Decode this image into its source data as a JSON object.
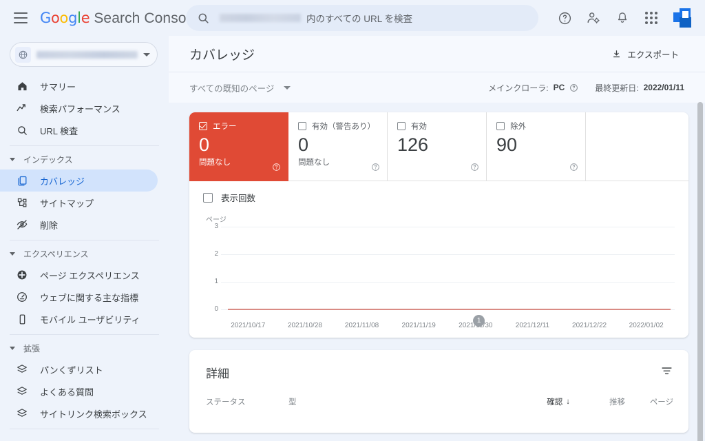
{
  "header": {
    "menu_icon": "hamburger-icon",
    "brand_google": [
      "G",
      "o",
      "o",
      "g",
      "l",
      "e"
    ],
    "brand_product": "Search Console",
    "search": {
      "icon": "search-icon",
      "placeholder_suffix": "内のすべての URL を検査",
      "value": ""
    },
    "icons": {
      "help": "help-icon",
      "account_settings": "account-settings-icon",
      "notifications": "bell-icon",
      "apps": "apps-grid-icon",
      "avatar": "avatar-logo"
    }
  },
  "sidebar": {
    "property_selector": {
      "icon": "globe-icon",
      "value": "",
      "chevron": "chevron-down-icon"
    },
    "items": [
      {
        "label": "サマリー",
        "icon": "home-icon",
        "active": false
      },
      {
        "label": "検索パフォーマンス",
        "icon": "trending-up-icon",
        "active": false
      },
      {
        "label": "URL 検査",
        "icon": "search-icon",
        "active": false
      }
    ],
    "groups": [
      {
        "label": "インデックス",
        "items": [
          {
            "label": "カバレッジ",
            "icon": "pages-copy-icon",
            "active": true
          },
          {
            "label": "サイトマップ",
            "icon": "sitemap-icon",
            "active": false
          },
          {
            "label": "削除",
            "icon": "eye-off-icon",
            "active": false
          }
        ]
      },
      {
        "label": "エクスペリエンス",
        "items": [
          {
            "label": "ページ エクスペリエンス",
            "icon": "page-experience-icon",
            "active": false
          },
          {
            "label": "ウェブに関する主な指標",
            "icon": "core-web-vitals-icon",
            "active": false
          },
          {
            "label": "モバイル ユーザビリティ",
            "icon": "mobile-icon",
            "active": false
          }
        ]
      },
      {
        "label": "拡張",
        "items": [
          {
            "label": "パンくずリスト",
            "icon": "layers-icon",
            "active": false
          },
          {
            "label": "よくある質問",
            "icon": "layers-icon",
            "active": false
          },
          {
            "label": "サイトリンク検索ボックス",
            "icon": "layers-icon",
            "active": false
          }
        ]
      }
    ]
  },
  "main": {
    "page_title": "カバレッジ",
    "export_label": "エクスポート",
    "export_icon": "download-icon",
    "filter_dropdown": "すべての既知のページ",
    "crawler_label": "メインクローラ:",
    "crawler_value": "PC",
    "crawler_help_icon": "help-circle-icon",
    "last_updated_label": "最終更新日:",
    "last_updated_value": "2022/01/11"
  },
  "cards": [
    {
      "label": "エラー",
      "value": "0",
      "sub": "問題なし",
      "selected": true,
      "style": "error"
    },
    {
      "label": "有効（警告あり）",
      "value": "0",
      "sub": "問題なし",
      "selected": false,
      "style": "warning"
    },
    {
      "label": "有効",
      "value": "126",
      "sub": "",
      "selected": false,
      "style": "valid"
    },
    {
      "label": "除外",
      "value": "90",
      "sub": "",
      "selected": false,
      "style": "excluded"
    }
  ],
  "chart_controls": {
    "impressions_label": "表示回数",
    "impressions_checked": false
  },
  "chart_data": {
    "type": "line",
    "title": "",
    "ylabel": "ページ",
    "xlabel": "",
    "ylim": [
      0,
      3
    ],
    "yticks": [
      "3",
      "2",
      "1",
      "0"
    ],
    "grid": true,
    "legend": "none",
    "categories": [
      "2021/10/17",
      "2021/10/28",
      "2021/11/08",
      "2021/11/19",
      "2021/11/30",
      "2021/12/11",
      "2021/12/22",
      "2022/01/02"
    ],
    "series": [
      {
        "name": "エラー",
        "color": "#d98b84",
        "values": [
          0,
          0,
          0,
          0,
          0,
          0,
          0,
          0
        ]
      }
    ],
    "annotations": [
      {
        "label": "1",
        "x_position_pct": 57
      }
    ]
  },
  "details": {
    "title": "詳細",
    "filter_icon": "filter-icon",
    "columns": [
      {
        "key": "status",
        "label": "ステータス"
      },
      {
        "key": "type",
        "label": "型"
      },
      {
        "key": "validation",
        "label": "確認",
        "sort": "↓"
      },
      {
        "key": "trend",
        "label": "推移"
      },
      {
        "key": "pages",
        "label": "ページ"
      }
    ],
    "rows": []
  },
  "colors": {
    "error_red": "#e04a35",
    "accent_blue": "#1a73e8",
    "active_nav_bg": "#d2e3fc",
    "page_bg": "#eef3fb",
    "line_color": "#d98b84"
  }
}
